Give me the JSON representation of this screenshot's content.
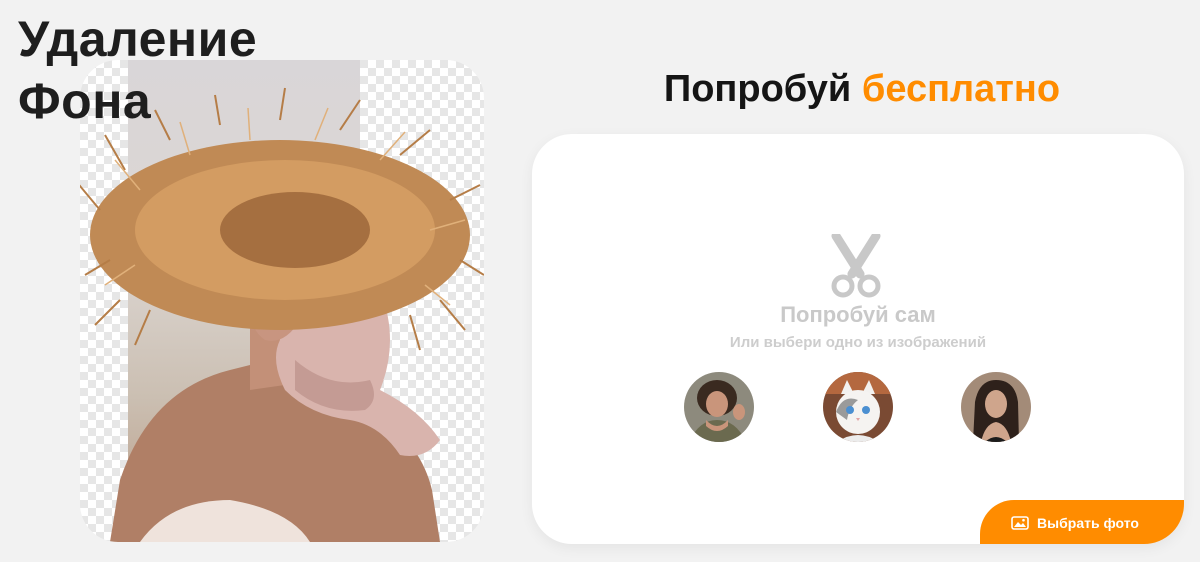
{
  "hero": {
    "title_line1": "Удаление",
    "title_line2": "Фона"
  },
  "try_section": {
    "title_main": "Попробуй",
    "title_accent": "бесплатно",
    "accent_color": "#ff8c00"
  },
  "upload_panel": {
    "heading": "Попробуй сам",
    "subheading": "Или выбери одно из изображений",
    "icon": "scissors-icon",
    "samples": [
      {
        "name": "sample-woman-curly",
        "icon": "portrait"
      },
      {
        "name": "sample-cat",
        "icon": "cat"
      },
      {
        "name": "sample-woman-dark",
        "icon": "portrait"
      }
    ],
    "choose_button_label": "Выбрать фото",
    "choose_button_icon": "image-icon"
  }
}
